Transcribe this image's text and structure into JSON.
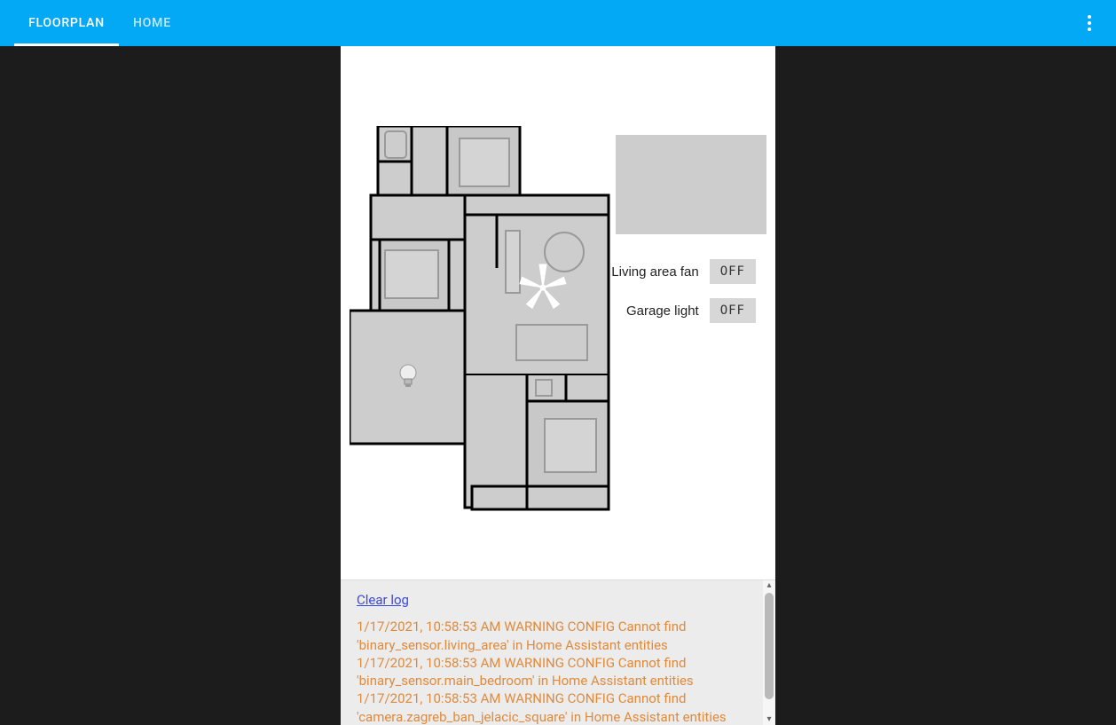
{
  "header": {
    "tabs": [
      {
        "label": "FLOORPLAN",
        "active": true
      },
      {
        "label": "HOME",
        "active": false
      }
    ]
  },
  "controls": {
    "fan": {
      "label": "Living area fan",
      "state": "OFF"
    },
    "garage": {
      "label": "Garage light",
      "state": "OFF"
    }
  },
  "log": {
    "clear_label": "Clear log",
    "entries": [
      "1/17/2021, 10:58:53 AM WARNING CONFIG Cannot find 'binary_sensor.living_area' in Home Assistant entities",
      "1/17/2021, 10:58:53 AM WARNING CONFIG Cannot find 'binary_sensor.main_bedroom' in Home Assistant entities",
      "1/17/2021, 10:58:53 AM WARNING CONFIG Cannot find 'camera.zagreb_ban_jelacic_square' in Home Assistant entities"
    ]
  },
  "icons": {
    "menu": "more-vert-icon",
    "bulb": "lightbulb-icon",
    "fan": "ceiling-fan-icon"
  }
}
